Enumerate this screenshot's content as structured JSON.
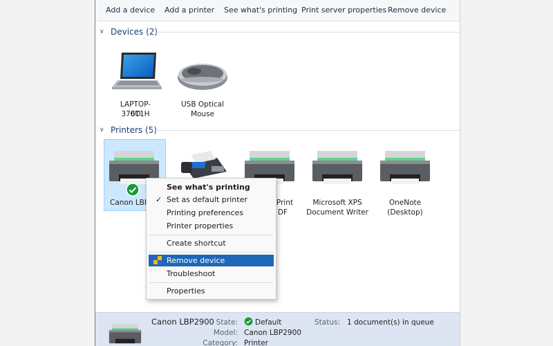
{
  "toolbar": {
    "add_device": "Add a device",
    "add_printer": "Add a printer",
    "see_printing": "See what's printing",
    "print_server": "Print server properties",
    "remove_device": "Remove device"
  },
  "groups": {
    "devices": {
      "header": "Devices (2)"
    },
    "printers": {
      "header": "Printers (5)"
    }
  },
  "devices": [
    {
      "label_line1": "LAPTOP-376T1H",
      "label_line2": "0O",
      "icon": "laptop-icon"
    },
    {
      "label_line1": "USB Optical",
      "label_line2": "Mouse",
      "icon": "mouse-icon"
    }
  ],
  "printers": [
    {
      "label_line1": "Canon LBP2",
      "label_line2": "",
      "icon": "printer-icon",
      "default": true
    },
    {
      "label_line1": "",
      "label_line2": "",
      "icon": "fax-icon"
    },
    {
      "label_line1": "t Print",
      "label_line2": "DF",
      "icon": "printer-icon"
    },
    {
      "label_line1": "Microsoft XPS",
      "label_line2": "Document Writer",
      "icon": "printer-icon"
    },
    {
      "label_line1": "OneNote",
      "label_line2": "(Desktop)",
      "icon": "printer-icon"
    }
  ],
  "context_menu": {
    "see_printing": "See what's printing",
    "set_default": "Set as default printer",
    "set_default_check": "✓",
    "preferences": "Printing preferences",
    "printer_props": "Printer properties",
    "create_shortcut": "Create shortcut",
    "remove_device": "Remove device",
    "troubleshoot": "Troubleshoot",
    "properties": "Properties"
  },
  "details": {
    "name": "Canon LBP2900",
    "state_key": "State:",
    "state_value": "Default",
    "model_key": "Model:",
    "model_value": "Canon LBP2900",
    "category_key": "Category:",
    "category_value": "Printer",
    "status_key": "Status:",
    "status_value": "1 document(s) in queue"
  },
  "colors": {
    "selection": "#cce8ff",
    "menu_highlight": "#1e67b8",
    "default_check": "#1a9a36",
    "printer_green": "#5fd48c"
  }
}
